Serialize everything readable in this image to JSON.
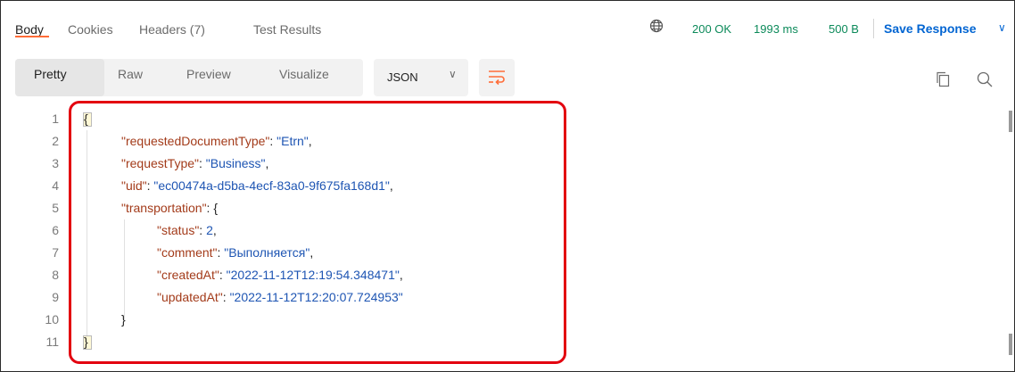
{
  "tabs": [
    {
      "label": "Body"
    },
    {
      "label": "Cookies"
    },
    {
      "label": "Headers (7)"
    },
    {
      "label": "Test Results"
    }
  ],
  "status": {
    "code": "200 OK",
    "time": "1993 ms",
    "size": "500 B",
    "color": "#0c8a5a"
  },
  "save_response": {
    "label": "Save Response",
    "chevron": "∨"
  },
  "view_modes": [
    {
      "label": "Pretty"
    },
    {
      "label": "Raw"
    },
    {
      "label": "Preview"
    },
    {
      "label": "Visualize"
    }
  ],
  "format": {
    "selected": "JSON",
    "chevron": "∨"
  },
  "icons": [
    "globe-icon",
    "wrap-lines-icon",
    "copy-icon",
    "search-icon"
  ],
  "code_lines": [
    {
      "n": "1",
      "text": "{"
    },
    {
      "n": "2",
      "key": "\"requestedDocumentType\"",
      "value": "\"Etrn\""
    },
    {
      "n": "3",
      "key": "\"requestType\"",
      "value": "\"Business\""
    },
    {
      "n": "4",
      "key": "\"uid\"",
      "value": "\"ec00474a-d5ba-4ecf-83a0-9f675fa168d1\""
    },
    {
      "n": "5",
      "key": "\"transportation\"",
      "value": "{"
    },
    {
      "n": "6",
      "key": "\"status\"",
      "value": "2"
    },
    {
      "n": "7",
      "key": "\"comment\"",
      "value": "\"Выполняется\""
    },
    {
      "n": "8",
      "key": "\"createdAt\"",
      "value": "\"2022-11-12T12:19:54.348471\""
    },
    {
      "n": "9",
      "key": "\"updatedAt\"",
      "value": "\"2022-11-12T12:20:07.724953\""
    },
    {
      "n": "10",
      "text": "}"
    },
    {
      "n": "11",
      "text": "}"
    }
  ],
  "colors": {
    "accent_tab": "#ff6c37",
    "highlight": "#e3000f",
    "key": "#a33b1a",
    "string": "#1e55b3",
    "link": "#0265d2"
  }
}
